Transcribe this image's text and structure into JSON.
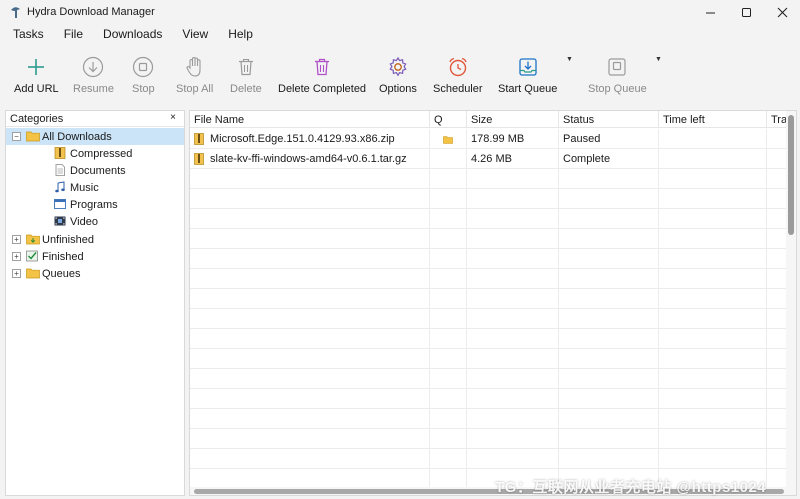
{
  "window": {
    "title": "Hydra Download Manager"
  },
  "menu": [
    "Tasks",
    "File",
    "Downloads",
    "View",
    "Help"
  ],
  "toolbar": [
    {
      "label": "Add URL",
      "icon": "plus-icon",
      "enabled": true
    },
    {
      "label": "Resume",
      "icon": "arrow-down-circle-icon",
      "enabled": false
    },
    {
      "label": "Stop",
      "icon": "stop-circle-icon",
      "enabled": false
    },
    {
      "label": "Stop All",
      "icon": "hand-icon",
      "enabled": false
    },
    {
      "label": "Delete",
      "icon": "trash-icon",
      "enabled": false
    },
    {
      "label": "Delete Completed",
      "icon": "trash-purple-icon",
      "enabled": true
    },
    {
      "label": "Options",
      "icon": "gear-icon",
      "enabled": true
    },
    {
      "label": "Scheduler",
      "icon": "alarm-clock-icon",
      "enabled": true
    },
    {
      "label": "Start Queue",
      "icon": "tray-download-icon",
      "enabled": true
    },
    {
      "label": "Stop Queue",
      "icon": "tray-stop-icon",
      "enabled": false
    }
  ],
  "categories": {
    "header": "Categories",
    "close": "×",
    "tree": [
      {
        "label": "All Downloads",
        "level": 0,
        "expander": "−",
        "icon": "folder-open-icon",
        "selected": true
      },
      {
        "label": "Compressed",
        "level": 1,
        "icon": "compressed-icon"
      },
      {
        "label": "Documents",
        "level": 1,
        "icon": "document-icon"
      },
      {
        "label": "Music",
        "level": 1,
        "icon": "music-note-icon"
      },
      {
        "label": "Programs",
        "level": 1,
        "icon": "program-window-icon"
      },
      {
        "label": "Video",
        "level": 1,
        "icon": "video-film-icon"
      },
      {
        "label": "Unfinished",
        "level": 0,
        "expander": "+",
        "icon": "folder-download-icon"
      },
      {
        "label": "Finished",
        "level": 0,
        "expander": "+",
        "icon": "folder-check-icon"
      },
      {
        "label": "Queues",
        "level": 0,
        "expander": "+",
        "icon": "folder-icon"
      }
    ]
  },
  "table": {
    "columns": [
      "File Name",
      "Q",
      "Size",
      "Status",
      "Time left",
      "Transfer rate"
    ],
    "rows": [
      {
        "name": "Microsoft.Edge.151.0.4129.93.x86.zip",
        "q": "folder-small-icon",
        "size": "178.99 MB",
        "status": "Paused",
        "time_left": "",
        "rate": ""
      },
      {
        "name": "slate-kv-ffi-windows-amd64-v0.6.1.tar.gz",
        "q": "",
        "size": "4.26 MB",
        "status": "Complete",
        "time_left": "",
        "rate": ""
      }
    ]
  },
  "watermark": "TG：互联网从业者充电站 @https1024"
}
